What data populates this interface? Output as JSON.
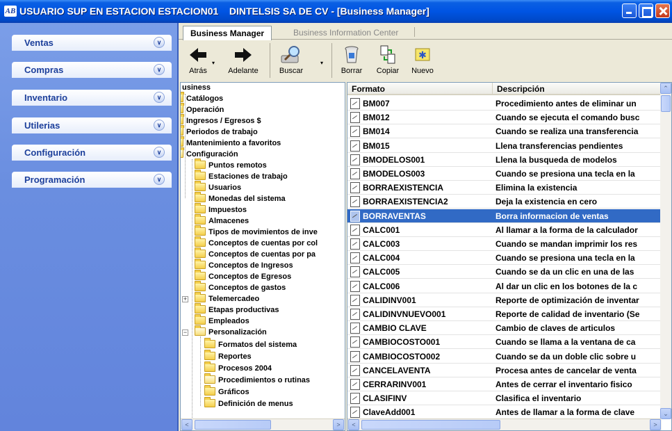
{
  "window": {
    "title": "USUARIO SUP EN ESTACION ESTACION01    DINTELSIS SA DE CV - [Business Manager]",
    "app_icon": "AB"
  },
  "nav": {
    "items": [
      {
        "label": "Ventas"
      },
      {
        "label": "Compras"
      },
      {
        "label": "Inventario"
      },
      {
        "label": "Utilerias"
      },
      {
        "label": "Configuración"
      },
      {
        "label": "Programación"
      }
    ]
  },
  "tabs": [
    {
      "label": "Business Manager"
    },
    {
      "label": "Business Information Center"
    }
  ],
  "toolbar": {
    "back": "Atrás",
    "forward": "Adelante",
    "search": "Buscar",
    "delete": "Borrar",
    "copy": "Copiar",
    "new": "Nuevo"
  },
  "tree": {
    "items": [
      {
        "label": "usiness"
      },
      {
        "label": "Catálogos"
      },
      {
        "label": "Operación"
      },
      {
        "label": "Ingresos / Egresos $"
      },
      {
        "label": "Periodos de trabajo"
      },
      {
        "label": "Mantenimiento a favoritos"
      },
      {
        "label": "Configuración"
      },
      {
        "label": "Puntos remotos"
      },
      {
        "label": "Estaciones de trabajo"
      },
      {
        "label": "Usuarios"
      },
      {
        "label": "Monedas del sistema"
      },
      {
        "label": "Impuestos"
      },
      {
        "label": "Almacenes"
      },
      {
        "label": "Tipos de movimientos de inve"
      },
      {
        "label": "Conceptos de cuentas por col"
      },
      {
        "label": "Conceptos de cuentas por pa"
      },
      {
        "label": "Conceptos de Ingresos"
      },
      {
        "label": "Conceptos de Egresos"
      },
      {
        "label": "Conceptos de gastos"
      },
      {
        "label": "Telemercadeo"
      },
      {
        "label": "Etapas productivas"
      },
      {
        "label": "Empleados"
      },
      {
        "label": "Personalización"
      },
      {
        "label": "Formatos del sistema"
      },
      {
        "label": "Reportes"
      },
      {
        "label": "Procesos 2004"
      },
      {
        "label": "Procedimientos o rutinas"
      },
      {
        "label": "Gráficos"
      },
      {
        "label": "Definición de menus"
      }
    ]
  },
  "grid": {
    "columns": [
      "Formato",
      "Descripción"
    ],
    "rows": [
      {
        "fmt": "BM007",
        "desc": "Procedimiento antes de eliminar un"
      },
      {
        "fmt": "BM012",
        "desc": "Cuando se ejecuta el comando busc"
      },
      {
        "fmt": "BM014",
        "desc": "Cuando se realiza una transferencia"
      },
      {
        "fmt": "BM015",
        "desc": "Llena transferencias pendientes"
      },
      {
        "fmt": "BMODELOS001",
        "desc": "Llena la busqueda de modelos"
      },
      {
        "fmt": "BMODELOS003",
        "desc": "Cuando se presiona una tecla en la"
      },
      {
        "fmt": "BORRAEXISTENCIA",
        "desc": "Elimina la existencia"
      },
      {
        "fmt": "BORRAEXISTENCIA2",
        "desc": "Deja la existencia en cero"
      },
      {
        "fmt": "BORRAVENTAS",
        "desc": "Borra informacion de ventas"
      },
      {
        "fmt": "CALC001",
        "desc": "Al llamar a la forma de la calculador"
      },
      {
        "fmt": "CALC003",
        "desc": "Cuando se mandan imprimir los res"
      },
      {
        "fmt": "CALC004",
        "desc": "Cuando se presiona una tecla en la"
      },
      {
        "fmt": "CALC005",
        "desc": "Cuando se da un clic en una de las"
      },
      {
        "fmt": "CALC006",
        "desc": "Al dar un clic en los botones de la c"
      },
      {
        "fmt": "CALIDINV001",
        "desc": "Reporte de optimización de inventar"
      },
      {
        "fmt": "CALIDINVNUEVO001",
        "desc": "Reporte de calidad de inventario (Se"
      },
      {
        "fmt": "CAMBIO CLAVE",
        "desc": "Cambio de claves de articulos"
      },
      {
        "fmt": "CAMBIOCOSTO001",
        "desc": "Cuando se llama a la ventana de ca"
      },
      {
        "fmt": "CAMBIOCOSTO002",
        "desc": "Cuando se da un doble clic sobre u"
      },
      {
        "fmt": "CANCELAVENTA",
        "desc": "Procesa antes de cancelar de venta"
      },
      {
        "fmt": "CERRARINV001",
        "desc": "Antes de cerrar el inventario fisico"
      },
      {
        "fmt": "CLASIFINV",
        "desc": "Clasifica el inventario"
      },
      {
        "fmt": "ClaveAdd001",
        "desc": "Antes de llamar a la forma de clave"
      }
    ],
    "selected_fmt": "BORRAVENTAS"
  },
  "colors": {
    "title_bar": "#0054e3",
    "nav_panel": "#6a8ee0",
    "selection": "#316ac5"
  }
}
